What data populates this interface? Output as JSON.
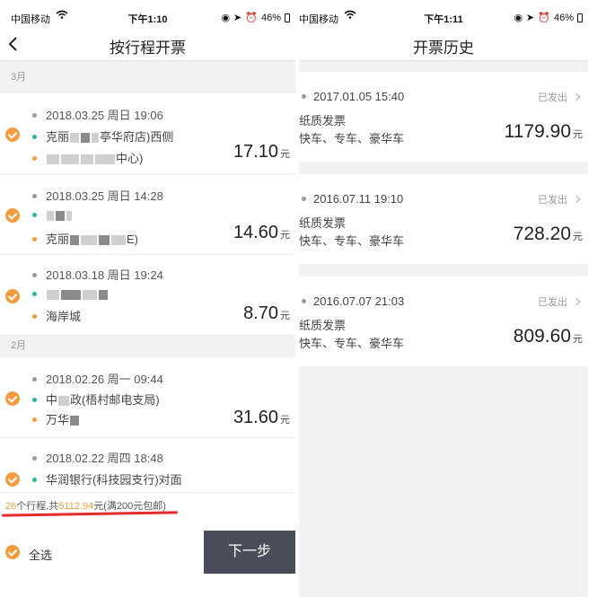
{
  "left": {
    "status": {
      "carrier": "中国移动",
      "time": "下午1:10",
      "battery": "46%"
    },
    "nav": {
      "title": "按行程开票"
    },
    "months": [
      "3月",
      "2月"
    ],
    "trips": [
      {
        "datetime": "2018.03.25 周日 19:06",
        "from": "克丽",
        "from_tail": "亭华府店)西侧",
        "to": "",
        "to_tail": "中心)",
        "price": "17.10",
        "unit": "元"
      },
      {
        "datetime": "2018.03.25 周日 14:28",
        "from": "",
        "from_tail": "",
        "to": "克丽",
        "to_tail": "E)",
        "price": "14.60",
        "unit": "元"
      },
      {
        "datetime": "2018.03.18 周日 19:24",
        "from": "",
        "from_tail": "",
        "to": "海岸城",
        "to_tail": "",
        "price": "8.70",
        "unit": "元"
      },
      {
        "datetime": "2018.02.26 周一 09:44",
        "from": "中",
        "from_tail": "政(梧村邮电支局)",
        "to": "万华",
        "to_tail": "",
        "price": "31.60",
        "unit": "元"
      },
      {
        "datetime": "2018.02.22 周四 18:48",
        "from": "华润银行(科技园支行)对面",
        "from_tail": "",
        "to": "",
        "to_tail": "",
        "price": "",
        "unit": ""
      }
    ],
    "summary": {
      "count": "26",
      "count_label": "个行程,共",
      "total": "5112.94",
      "suffix": "元(满200元包邮)"
    },
    "select_all": "全选",
    "next_button": "下一步"
  },
  "right": {
    "status": {
      "carrier": "中国移动",
      "time": "下午1:11",
      "battery": "46%"
    },
    "nav": {
      "title": "开票历史"
    },
    "records": [
      {
        "datetime": "2017.01.05 15:40",
        "status": "已发出",
        "kind": "纸质发票",
        "types": "快车、专车、豪华车",
        "amount": "1179.90",
        "unit": "元"
      },
      {
        "datetime": "2016.07.11 19:10",
        "status": "已发出",
        "kind": "纸质发票",
        "types": "快车、专车、豪华车",
        "amount": "728.20",
        "unit": "元"
      },
      {
        "datetime": "2016.07.07 21:03",
        "status": "已发出",
        "kind": "纸质发票",
        "types": "快车、专车、豪华车",
        "amount": "809.60",
        "unit": "元"
      }
    ]
  },
  "colors": {
    "accent": "#f39c3d",
    "green_dot": "#29b6a0",
    "button_bg": "#4a4d57",
    "annotation_red": "#e52b2b"
  }
}
